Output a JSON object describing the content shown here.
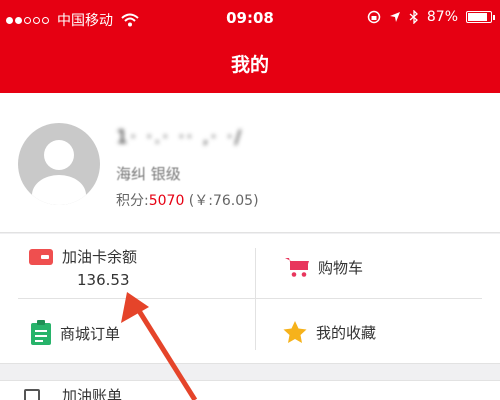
{
  "status_bar": {
    "carrier": "中国移动",
    "time": "09:08",
    "battery": "87%",
    "battery_level": 0.87,
    "signal_full": 2,
    "signal_empty": 3
  },
  "header": {
    "title": "我的"
  },
  "profile": {
    "username": "1· ·.· ·· ,· ·/",
    "level": "海纠 银级",
    "points_label": "积分:",
    "points_value": "5070",
    "points_money": " (￥:76.05)"
  },
  "grid": {
    "fuel_label": "加油卡余额",
    "fuel_amount": "136.53",
    "cart_label": "购物车",
    "order_label": "商城订单",
    "fav_label": "我的收藏"
  },
  "next_row": {
    "label": "加油账单"
  },
  "colors": {
    "brand_red": "#e60012",
    "arrow": "#e5442a",
    "cart": "#e8365d",
    "order": "#27b36a",
    "star": "#f6b21b"
  }
}
